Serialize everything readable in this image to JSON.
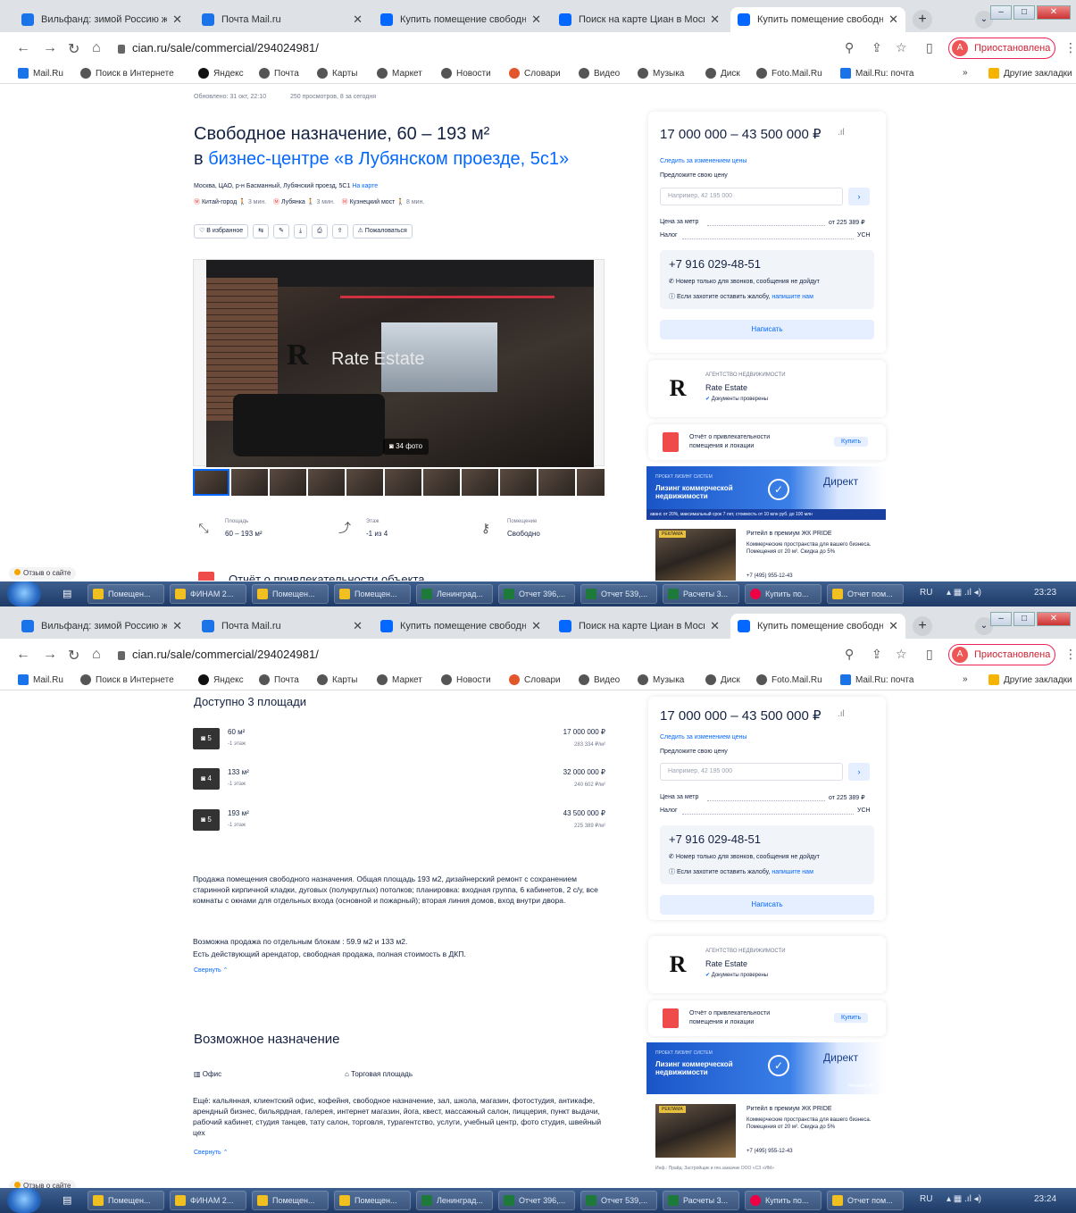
{
  "browser": {
    "tabs": [
      {
        "label": "Вильфанд: зимой Россию ждё",
        "color": "#1a73e8"
      },
      {
        "label": "Почта Mail.ru",
        "color": "#1a73e8"
      },
      {
        "label": "Купить помещение свободног",
        "color": "#0468ff"
      },
      {
        "label": "Поиск на карте Циан в Моск",
        "color": "#0468ff"
      },
      {
        "label": "Купить помещение свободног",
        "color": "#0468ff"
      }
    ],
    "close_glyph": "✕",
    "new_tab": "+",
    "url": "cian.ru/sale/commercial/294024981/",
    "profile_initial": "A",
    "profile_status": "Приостановлена",
    "bookmarks": [
      "Mail.Ru",
      "Поиск в Интернете",
      "Яндекс",
      "Почта",
      "Карты",
      "Маркет",
      "Новости",
      "Словари",
      "Видео",
      "Музыка",
      "Диск",
      "Foto.Mail.Ru",
      "Mail.Ru: почта"
    ],
    "other_bookmarks": "Другие закладки",
    "bookmarks_more": "»"
  },
  "taskbar": {
    "items": [
      "Помещен...",
      "ФИНАМ 2...",
      "Помещен...",
      "Помещен...",
      "Ленинград...",
      "Отчет 396,...",
      "Отчет 539,...",
      "Расчеты 3...",
      "Купить по...",
      "Отчет пом..."
    ],
    "lang": "RU",
    "time1": "23:23",
    "time2": "23:24"
  },
  "feedback_link": "Отзыв о сайте",
  "listing": {
    "published": "Обновлено: 31 окт, 22:10",
    "views": "250 просмотров, 8 за сегодня",
    "title": "Свободное назначение, 60 – 193 м²",
    "subtitle_prefix": "в",
    "subtitle_link": "бизнес-центре «в Лубянском проезде, 5с1»",
    "address": "Москва, ЦАО, р-н Басманный, Лубянский проезд, 5С1",
    "on_map": "На карте",
    "metro": [
      {
        "name": "Китай-город",
        "time": "3 мин."
      },
      {
        "name": "Лубянка",
        "time": "3 мин."
      },
      {
        "name": "Кузнецкий мост",
        "time": "8 мин."
      }
    ],
    "fav_button": "В избранное",
    "complain_button": "Пожаловаться",
    "photo_count": "34 фото",
    "watermark": "Rate Estate",
    "stats": [
      {
        "label": "Площадь",
        "value": "60 – 193 м²"
      },
      {
        "label": "Этаж",
        "value": "-1 из 4"
      },
      {
        "label": "Помещение",
        "value": "Свободно"
      }
    ],
    "report_heading_cut": "Отчёт о привлекательности объекта"
  },
  "sidebar": {
    "price": "17 000 000 – 43 500 000 ₽",
    "follow": "Следить за изменением цены",
    "offer_label": "Предложите свою цену",
    "offer_placeholder": "Например, 42 195 000",
    "offer_btn": "›",
    "price_per_m_label": "Цена за метр",
    "price_per_m_value": "от 225 389 ₽",
    "tax_label": "Налог",
    "tax_value": "УСН",
    "phone": "+7 916 029-48-51",
    "phone_note": "Номер только для звонков, сообщения не дойдут",
    "complain_note_prefix": "Если захотите оставить жалобу,",
    "complain_note_link": "напишите нам",
    "write_btn": "Написать",
    "agency_label": "АГЕНТСТВО НЕДВИЖИМОСТИ",
    "agency_name": "Rate Estate",
    "agency_docs": "Документы проверены",
    "report_text": "Отчёт о привлекательности помещения и локации",
    "report_buy": "Купить",
    "ad_small": "ПРОЕКТ ЛИЗИНГ СИСТЕМ",
    "ad_title": "Лизинг коммерческой недвижимости",
    "ad_brand": "Директ",
    "ad_strip": "аванс от 20%, максимальный срок 7 лет, стоимость от 10 млн руб. до 100 млн",
    "ad_strip2": "Реклама. Ру",
    "promo_badge": "РЕКЛАМА",
    "promo_title": "Ритейл в премиум ЖК PRIDE",
    "promo_text": "Коммерческие пространства для вашего бизнеса. Помещения от 20 м². Скидка до 5%",
    "promo_phone": "+7 (495) 955-12-43",
    "promo_footer": "Инф.: Прайд. Застройщик и ген.заказчик ООО «СЗ «ИМ»"
  },
  "areas": {
    "heading": "Доступно 3 площади",
    "items": [
      {
        "photos": "5",
        "area": "60 м²",
        "floor": "-1 этаж",
        "price": "17 000 000 ₽",
        "per_m": "283 334 ₽/м²"
      },
      {
        "photos": "4",
        "area": "133 м²",
        "floor": "-1 этаж",
        "price": "32 000 000 ₽",
        "per_m": "240 602 ₽/м²"
      },
      {
        "photos": "5",
        "area": "193 м²",
        "floor": "-1 этаж",
        "price": "43 500 000 ₽",
        "per_m": "225 389 ₽/м²"
      }
    ]
  },
  "description": {
    "p1": "Продажа помещения свободного назначения. Общая площадь 193 м2, дизайнерский ремонт с сохранением старинной кирпичной кладки, дуговых (полукруглых) потолков; планировка: входная группа, 6 кабинетов, 2 с/у, все комнаты с окнами для отдельных входа (основной и пожарный); вторая линия домов, вход внутри двора.",
    "p2": "Возможна продажа по отдельным блокам : 59.9 м2 и 133 м2.",
    "p3": "Есть действующий арендатор, свободная продажа, полная стоимость в ДКП.",
    "collapse": "Свернуть"
  },
  "purpose": {
    "heading": "Возможное назначение",
    "tags": [
      "Офис",
      "Торговая площадь"
    ],
    "more": "Ещё: кальянная, клиентский офис, кофейня, свободное назначение, зал, школа, магазин, фотостудия, антикафе, арендный бизнес, бильярдная, галерея, интернет магазин, йога, квест, массажный салон, пиццерия, пункт выдачи, рабочий кабинет, студия танцев, тату салон, торговля, турагентство, услуги, учебный центр, фото студия, швейный цех",
    "collapse": "Свернуть"
  }
}
